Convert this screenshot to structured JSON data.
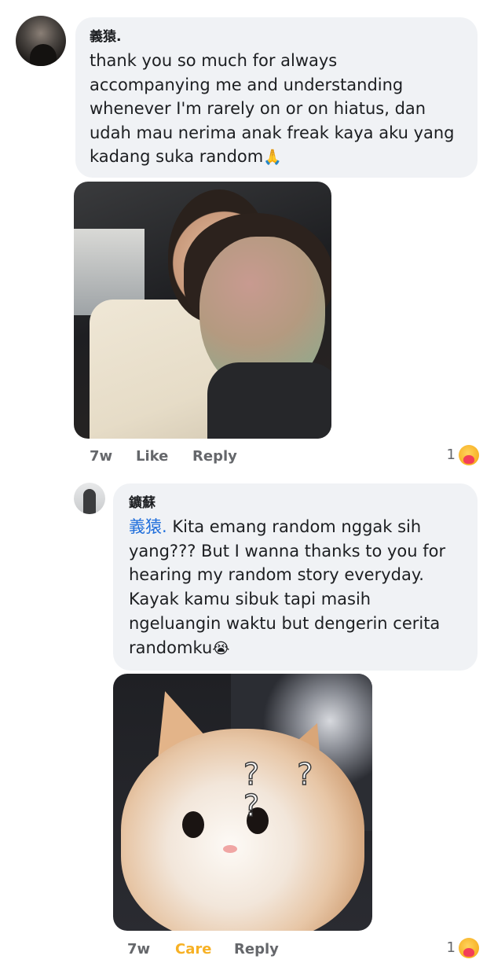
{
  "comment": {
    "author": "義猿.",
    "lines": [
      "thank you so much for always",
      "accompanying me and understanding",
      "whenever I'm rarely on or on hiatus, dan",
      "udah mau nerima anak freak kaya aku yang",
      "kadang suka random"
    ],
    "end_emoji": "🙏",
    "time": "7w",
    "like_label": "Like",
    "reply_label": "Reply",
    "reaction_count": "1",
    "reaction_icon": "care-emoji-icon"
  },
  "reply": {
    "author": "鑛蘇",
    "mention": "義猿.",
    "lines": [
      " Kita emang random nggak sih",
      "yang??? But I wanna thanks to you for",
      "hearing my random story everyday.",
      "Kayak kamu sibuk tapi masih",
      "ngeluangin waktu but dengerin cerita",
      "randomku"
    ],
    "end_emoji": "😭",
    "image_overlay_text": "? ? ?",
    "time": "7w",
    "reaction_label": "Care",
    "reply_label": "Reply",
    "reaction_count": "1",
    "reaction_icon": "care-emoji-icon",
    "colors": {
      "mention": "#216fdb",
      "care": "#f7b125"
    }
  }
}
